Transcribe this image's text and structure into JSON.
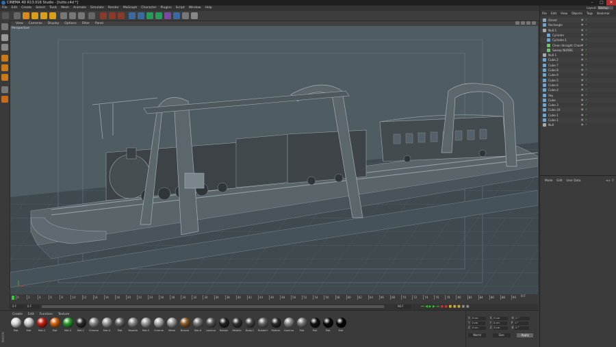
{
  "window": {
    "title": "CINEMA 4D R13.016 Studio - [tutto.c4d *]"
  },
  "menubar": [
    "File",
    "Edit",
    "Create",
    "Select",
    "Tools",
    "Mesh",
    "Animate",
    "Simulate",
    "Render",
    "MoGraph",
    "Character",
    "Plugins",
    "Script",
    "Window",
    "Help"
  ],
  "layout": {
    "label": "Layout:",
    "value": "Startup"
  },
  "viewport": {
    "menu": [
      "View",
      "Cameras",
      "Display",
      "Options",
      "Filter",
      "Panel"
    ],
    "label": "Perspective"
  },
  "objects": {
    "tabs": [
      "File",
      "Edit",
      "View",
      "Objects",
      "Tags",
      "Bookmar"
    ],
    "items": [
      {
        "name": "Oznat",
        "indent": 0,
        "color": "#8ab"
      },
      {
        "name": "Rectangle",
        "indent": 0,
        "color": "#6ad"
      },
      {
        "name": "Null.1",
        "indent": 0,
        "color": "#aaa"
      },
      {
        "name": "Cylinder",
        "indent": 1,
        "color": "#6ad"
      },
      {
        "name": "Cylinder.1",
        "indent": 1,
        "color": "#6ad"
      },
      {
        "name": "Clean Straight Chain",
        "indent": 1,
        "color": "#6c6"
      },
      {
        "name": "Sweep NURBS",
        "indent": 1,
        "color": "#6c6"
      },
      {
        "name": "Null.1",
        "indent": 0,
        "color": "#aaa"
      },
      {
        "name": "Cube.2",
        "indent": 0,
        "color": "#6ad"
      },
      {
        "name": "Cube.7",
        "indent": 0,
        "color": "#6ad"
      },
      {
        "name": "Cube.8",
        "indent": 0,
        "color": "#6ad"
      },
      {
        "name": "Cube.9",
        "indent": 0,
        "color": "#6ad"
      },
      {
        "name": "Cube.5",
        "indent": 0,
        "color": "#6ad"
      },
      {
        "name": "Cube.6",
        "indent": 0,
        "color": "#6ad"
      },
      {
        "name": "Cube.4",
        "indent": 0,
        "color": "#6ad"
      },
      {
        "name": "Sky",
        "indent": 0,
        "color": "#6ad"
      },
      {
        "name": "Cube",
        "indent": 0,
        "color": "#6ad"
      },
      {
        "name": "Cube.3",
        "indent": 0,
        "color": "#6ad"
      },
      {
        "name": "Cube.10",
        "indent": 0,
        "color": "#6ad"
      },
      {
        "name": "Cube.1",
        "indent": 0,
        "color": "#6ad"
      },
      {
        "name": "Cube.1",
        "indent": 0,
        "color": "#6ad"
      },
      {
        "name": "Null",
        "indent": 0,
        "color": "#aaa"
      }
    ]
  },
  "attributes": {
    "menu": [
      "Mode",
      "Edit",
      "User Data"
    ]
  },
  "timeline": {
    "ticks": [
      "0",
      "2",
      "4",
      "6",
      "8",
      "10",
      "12",
      "14",
      "16",
      "18",
      "20",
      "22",
      "24",
      "26",
      "28",
      "30",
      "32",
      "34",
      "36",
      "38",
      "40",
      "42",
      "44",
      "46",
      "48",
      "50",
      "52",
      "54",
      "56",
      "58",
      "60",
      "62",
      "64",
      "66",
      "68",
      "70",
      "72",
      "74",
      "76",
      "78",
      "80",
      "82",
      "84",
      "86",
      "88",
      "90"
    ],
    "current_frame": "0 F",
    "start_field": "0 F",
    "end_field": "90 F",
    "end_label": "0 F"
  },
  "materials": {
    "menu": [
      "Create",
      "Edit",
      "Function",
      "Texture"
    ],
    "items": [
      {
        "name": "Mat",
        "color": "#d8d8d8"
      },
      {
        "name": "Mat",
        "color": "#c8c8c8"
      },
      {
        "name": "Mat.2",
        "color": "#c02010"
      },
      {
        "name": "Mat",
        "color": "#d06010"
      },
      {
        "name": "Mat.3",
        "color": "#2a9a2a"
      },
      {
        "name": "Mat.1",
        "color": "#2a2a2a"
      },
      {
        "name": "Chrome",
        "color": "#888888"
      },
      {
        "name": "Mat.4",
        "color": "#9a9a9a"
      },
      {
        "name": "Mat",
        "color": "#666666"
      },
      {
        "name": "Tassello",
        "color": "#888888"
      },
      {
        "name": "Mat.5",
        "color": "#9a9a9a"
      },
      {
        "name": "Chrome",
        "color": "#aaaaaa"
      },
      {
        "name": "Metal",
        "color": "#999999"
      },
      {
        "name": "Bronze",
        "color": "#8a5a2a"
      },
      {
        "name": "Mat.6",
        "color": "#777777"
      },
      {
        "name": "Lamiera",
        "color": "#555555"
      },
      {
        "name": "Rubber",
        "color": "#222222"
      },
      {
        "name": "Metallo",
        "color": "#333333"
      },
      {
        "name": "Body.1",
        "color": "#444444"
      },
      {
        "name": "Rubbert",
        "color": "#666666"
      },
      {
        "name": "Pattern",
        "color": "#2a2a2a"
      },
      {
        "name": "Gomma",
        "color": "#888888"
      },
      {
        "name": "Mat",
        "color": "#777777"
      },
      {
        "name": "Mat",
        "color": "#111111"
      },
      {
        "name": "Mat",
        "color": "#0a0a0a"
      },
      {
        "name": "Mat",
        "color": "#050505"
      }
    ]
  },
  "coords": {
    "rows": [
      {
        "a": "X",
        "av": "0 cm",
        "b": "X",
        "bv": "0 cm",
        "c": "H",
        "cv": "0 °"
      },
      {
        "a": "Y",
        "av": "0 cm",
        "b": "Y",
        "bv": "0 cm",
        "c": "P",
        "cv": "0 °"
      },
      {
        "a": "Z",
        "av": "0 cm",
        "b": "Z",
        "bv": "0 cm",
        "c": "B",
        "cv": "0 °"
      }
    ],
    "mode": "World",
    "size_mode": "Size",
    "apply_label": "Apply"
  }
}
